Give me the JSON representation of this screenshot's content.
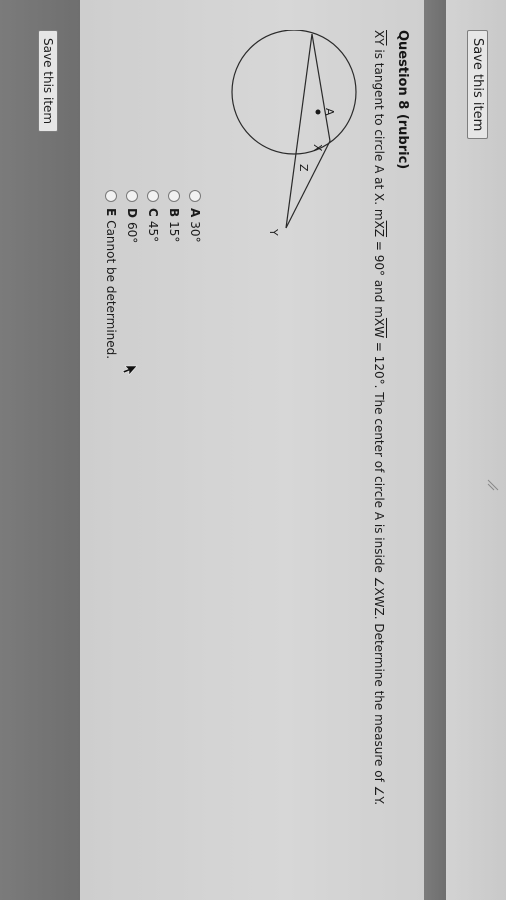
{
  "toolbar": {
    "save_label": "Save this item"
  },
  "question": {
    "title": "Question 8 (rubric)",
    "text_parts": {
      "p1": "XY",
      "p2": " is tangent to circle A at X. m",
      "arc1": "XZ",
      "p3": " = 90° and m",
      "arc2": "XW",
      "p4": " = 120°. The center of circle A is inside ∠XWZ. Determine the measure of ∠Y."
    }
  },
  "diagram": {
    "labels": {
      "w": "W",
      "x": "X",
      "a": "A",
      "z": "Z",
      "y": "Y"
    }
  },
  "options": [
    {
      "letter": "A",
      "text": "30°"
    },
    {
      "letter": "B",
      "text": "15°"
    },
    {
      "letter": "C",
      "text": "45°"
    },
    {
      "letter": "D",
      "text": "60°"
    },
    {
      "letter": "E",
      "text": "Cannot be determined."
    }
  ],
  "footer": {
    "save_label": "Save this item"
  }
}
